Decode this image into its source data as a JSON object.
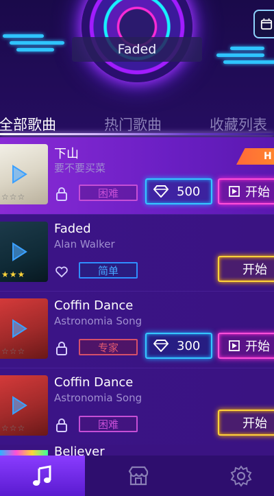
{
  "header": {
    "now_playing": "Faded"
  },
  "tabs": [
    {
      "label": "全部歌曲",
      "active": true
    },
    {
      "label": "热门歌曲",
      "active": false
    },
    {
      "label": "收藏列表",
      "active": false
    }
  ],
  "songs": [
    {
      "title": "下山",
      "artist": "要不要买菜",
      "difficulty": "困难",
      "price": "500",
      "start_label": "开始",
      "badge": "HOT",
      "locked": true,
      "stars": "☆☆☆"
    },
    {
      "title": "Faded",
      "artist": "Alan Walker",
      "difficulty": "简单",
      "start_label": "开始",
      "locked": false,
      "stars": "★★★"
    },
    {
      "title": "Coffin Dance",
      "artist": "Astronomia Song",
      "difficulty": "专家",
      "price": "300",
      "start_label": "开始",
      "locked": true,
      "stars": "☆☆☆"
    },
    {
      "title": "Coffin Dance",
      "artist": "Astronomia Song",
      "difficulty": "困难",
      "start_label": "开始",
      "locked": true,
      "stars": "☆☆☆"
    },
    {
      "title": "Believer"
    }
  ],
  "bottom_nav": [
    {
      "icon": "music-note-icon",
      "active": true
    },
    {
      "icon": "store-icon",
      "active": false
    },
    {
      "icon": "settings-gear-icon",
      "active": false
    }
  ],
  "colors": {
    "accent_pink": "#ff4fd8",
    "accent_cyan": "#36c6ff",
    "accent_yellow": "#ffd23a",
    "badge_orange": "#ff6a3a"
  }
}
